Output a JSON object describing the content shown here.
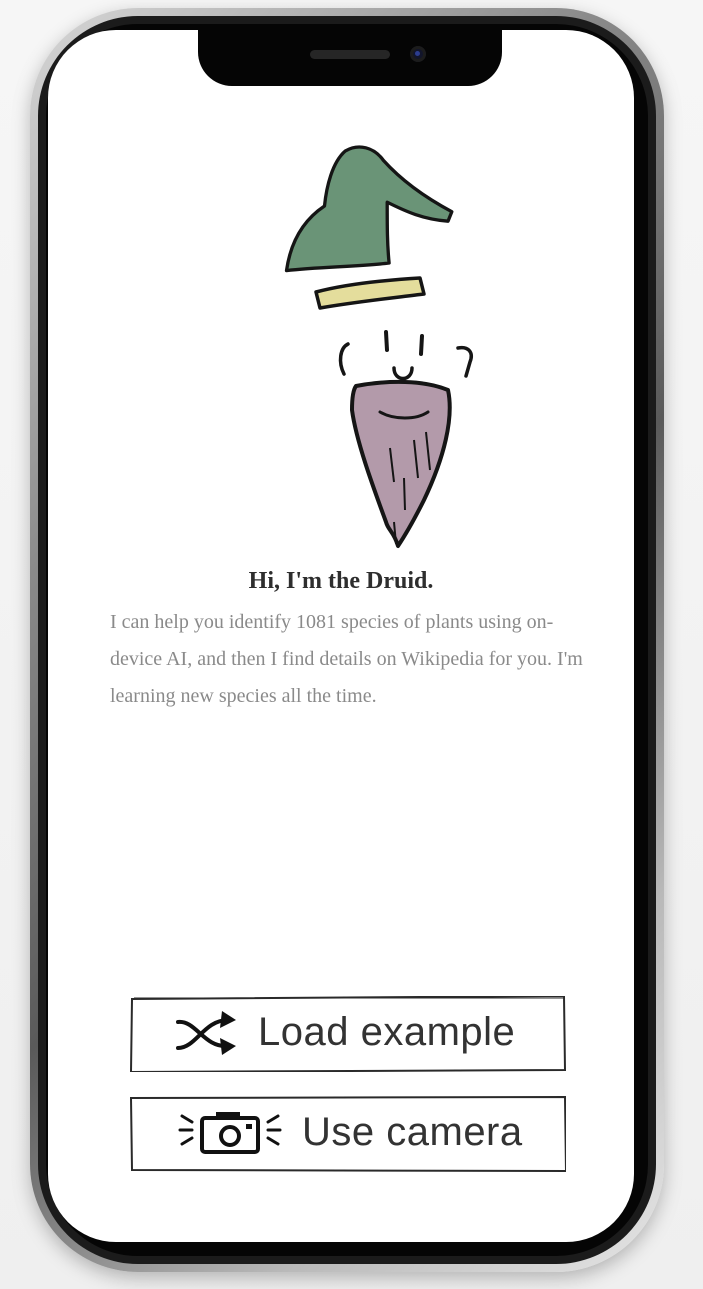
{
  "greeting": {
    "title": "Hi, I'm the Druid.",
    "body": "I can help you identify 1081 species of plants using on-device AI, and then I find details on Wikipedia for you. I'm learning new species all the time."
  },
  "actions": {
    "load_example": {
      "label": "Load example",
      "icon": "shuffle-icon"
    },
    "use_camera": {
      "label": "Use camera",
      "icon": "camera-icon"
    }
  },
  "colors": {
    "hat_green": "#6a9477",
    "hat_brim": "#e4dd9c",
    "beard": "#b39aaa",
    "ink": "#151515",
    "text_muted": "#8a8a8a"
  }
}
